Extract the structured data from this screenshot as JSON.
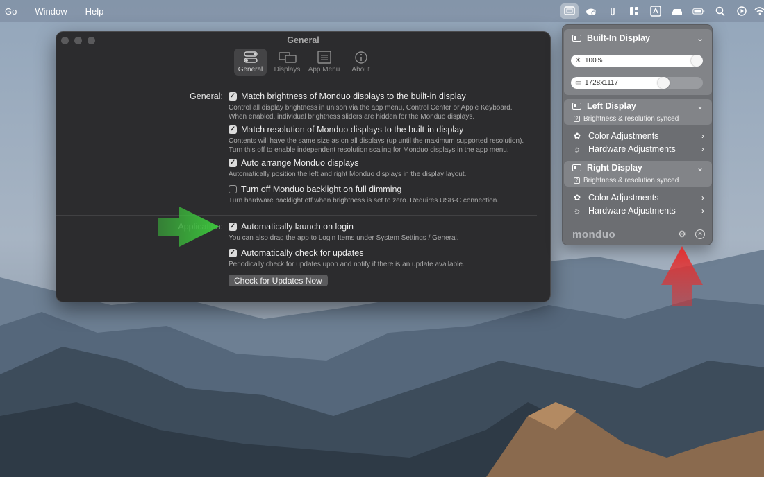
{
  "menubar": {
    "items": [
      "Go",
      "Window",
      "Help"
    ],
    "status_icons": [
      "monduo-display-icon",
      "weather-cloud-icon",
      "paperclip-icon",
      "window-layout-icon",
      "app-store-icon",
      "car-icon",
      "battery-charging-icon",
      "spotlight-search-icon",
      "play-circle-icon",
      "wifi-icon"
    ]
  },
  "window": {
    "title": "General",
    "tabs": [
      {
        "label": "General",
        "icon": "toggles-icon",
        "selected": true
      },
      {
        "label": "Displays",
        "icon": "displays-icon",
        "selected": false
      },
      {
        "label": "App Menu",
        "icon": "app-menu-icon",
        "selected": false
      },
      {
        "label": "About",
        "icon": "info-icon",
        "selected": false
      }
    ],
    "general_label": "General:",
    "application_label": "Application:",
    "options": [
      {
        "label": "Match brightness of Monduo displays to the built-in display",
        "checked": true,
        "desc": "Control all display brightness in unison via the app menu, Control Center or Apple Keyboard.\nWhen enabled, individual brightness sliders are hidden for the Monduo displays."
      },
      {
        "label": "Match resolution of Monduo displays to the built-in display",
        "checked": true,
        "desc": "Contents will have the same size as on all displays (up until the maximum supported resolution).\nTurn this off to enable independent resolution scaling for Monduo displays in the app menu."
      },
      {
        "label": "Auto arrange Monduo displays",
        "checked": true,
        "desc": "Automatically position the left and right Monduo displays in the display layout."
      },
      {
        "label": "Turn off Monduo backlight on full dimming",
        "checked": false,
        "desc": "Turn hardware backlight off when brightness is set to zero. Requires USB-C connection."
      },
      {
        "label": "Automatically launch on login",
        "checked": true,
        "desc": "You can also drag the app to Login Items under System Settings / General."
      },
      {
        "label": "Automatically check for updates",
        "checked": true,
        "desc": "Periodically check for updates upon and notify if there is an update available."
      }
    ],
    "check_updates_button": "Check for Updates Now"
  },
  "popover": {
    "builtin": {
      "title": "Built-In Display",
      "brightness": "100%",
      "brightness_level": 1.0,
      "resolution": "1728x1117",
      "resolution_level": 0.72
    },
    "left": {
      "title": "Left Display",
      "sync_note": "Brightness & resolution synced",
      "color_adj": "Color Adjustments",
      "hw_adj": "Hardware Adjustments"
    },
    "right": {
      "title": "Right Display",
      "sync_note": "Brightness & resolution synced",
      "color_adj": "Color Adjustments",
      "hw_adj": "Hardware Adjustments"
    },
    "logo": "monduo"
  },
  "colors": {
    "arrow_green": "#3cc23c",
    "arrow_red": "#e23030",
    "window_bg": "#2c2c2e"
  }
}
